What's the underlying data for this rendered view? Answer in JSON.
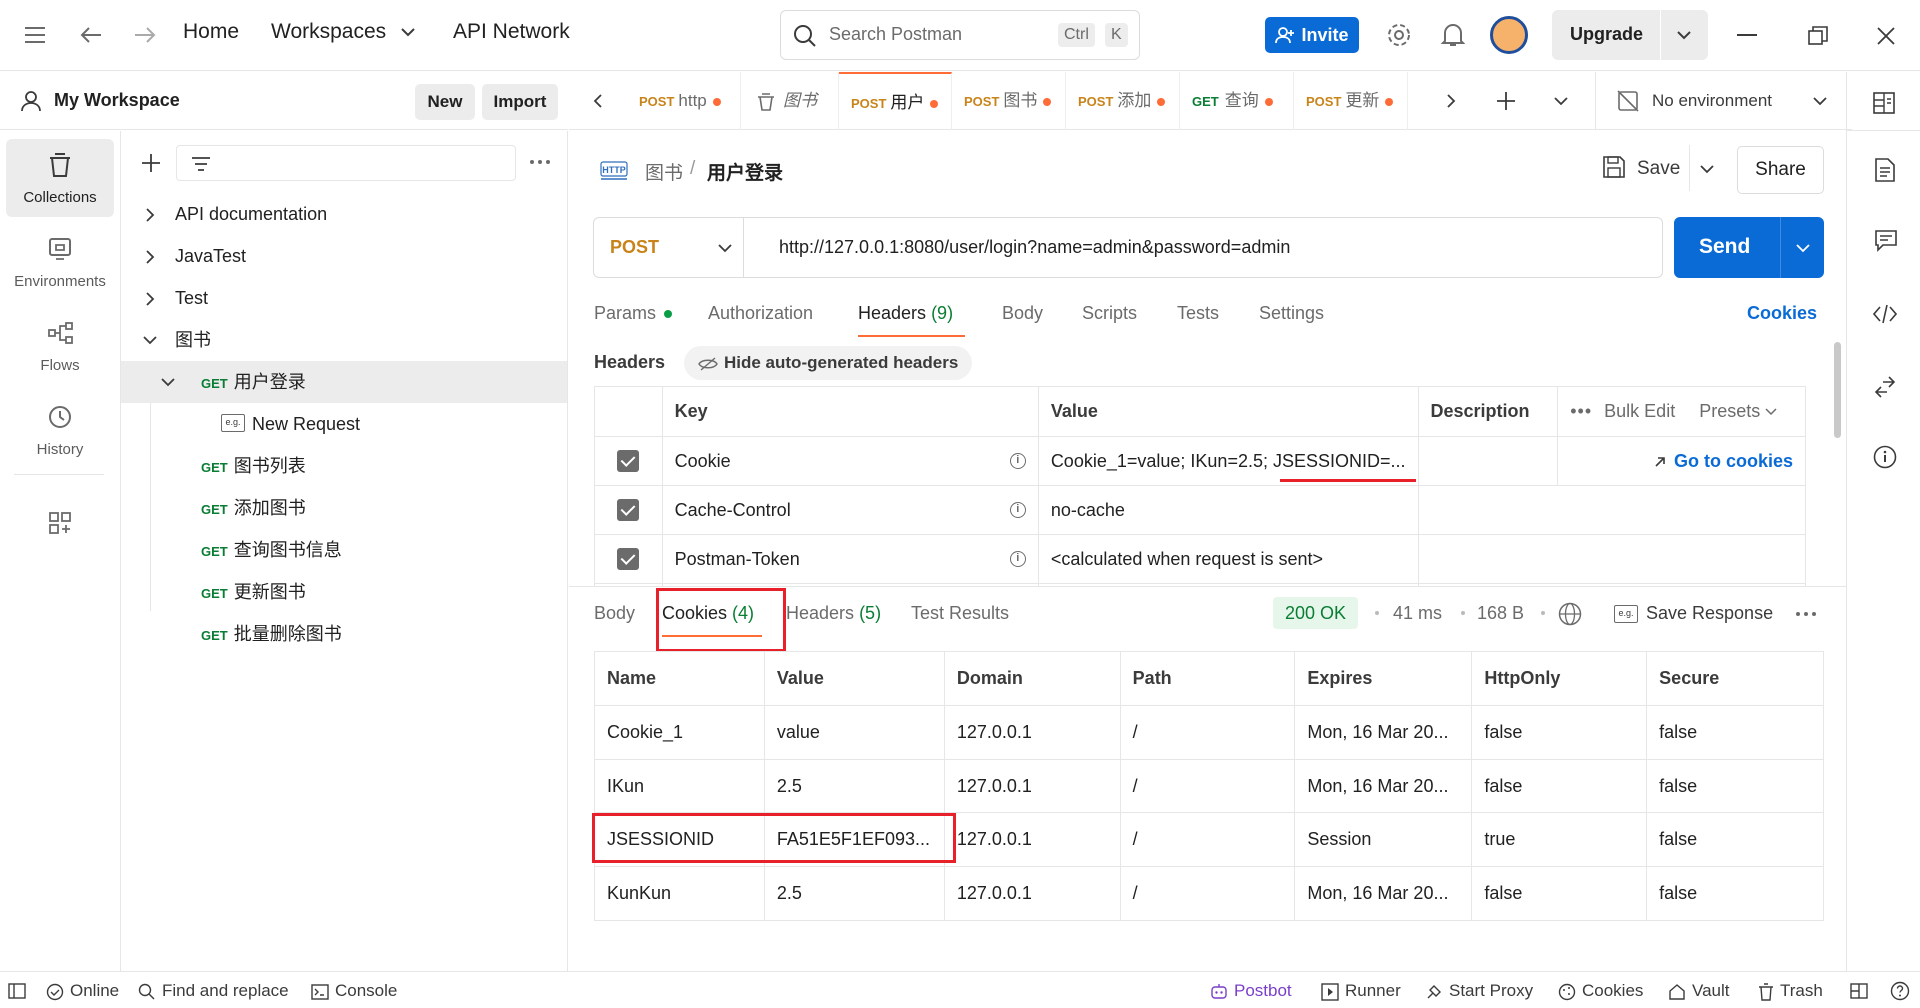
{
  "topbar": {
    "nav": [
      "Home",
      "Workspaces",
      "API Network"
    ],
    "search_placeholder": "Search Postman",
    "kbd_ctrl": "Ctrl",
    "kbd_k": "K",
    "invite": "Invite",
    "upgrade": "Upgrade"
  },
  "workspace": {
    "name": "My Workspace",
    "new": "New",
    "import": "Import"
  },
  "rail": [
    "Collections",
    "Environments",
    "Flows",
    "History"
  ],
  "tree": {
    "items": [
      {
        "label": "API documentation"
      },
      {
        "label": "JavaTest"
      },
      {
        "label": "Test"
      },
      {
        "label": "图书"
      }
    ],
    "requests": [
      {
        "method": "GET",
        "label": "用户登录"
      },
      {
        "badge": "e.g.",
        "label": "New Request"
      },
      {
        "method": "GET",
        "label": "图书列表"
      },
      {
        "method": "GET",
        "label": "添加图书"
      },
      {
        "method": "GET",
        "label": "查询图书信息"
      },
      {
        "method": "GET",
        "label": "更新图书"
      },
      {
        "method": "GET",
        "label": "批量删除图书"
      }
    ]
  },
  "tabs": [
    {
      "method": "POST",
      "label": "http"
    },
    {
      "method": "",
      "label": "图书"
    },
    {
      "method": "POST",
      "label": "用户"
    },
    {
      "method": "POST",
      "label": "图书"
    },
    {
      "method": "POST",
      "label": "添加"
    },
    {
      "method": "GET",
      "label": "查询"
    },
    {
      "method": "POST",
      "label": "更新"
    }
  ],
  "environment": "No environment",
  "request": {
    "breadcrumb_parent": "图书",
    "breadcrumb_sep": "/",
    "breadcrumb_current": "用户登录",
    "save": "Save",
    "share": "Share",
    "method": "POST",
    "url": "http://127.0.0.1:8080/user/login?name=admin&password=admin",
    "send": "Send",
    "tabs": {
      "params": "Params",
      "authorization": "Authorization",
      "headers": "Headers",
      "headers_count": "(9)",
      "body": "Body",
      "scripts": "Scripts",
      "tests": "Tests",
      "settings": "Settings",
      "cookies": "Cookies"
    },
    "headers_title": "Headers",
    "hide_auto": "Hide auto-generated headers",
    "header_cols": {
      "key": "Key",
      "value": "Value",
      "description": "Description",
      "bulk_edit": "Bulk Edit",
      "presets": "Presets"
    },
    "go_to_cookies": "Go to cookies",
    "header_rows": [
      {
        "key": "Cookie",
        "value": "Cookie_1=value; IKun=2.5; JSESSIONID=..."
      },
      {
        "key": "Cache-Control",
        "value": "no-cache"
      },
      {
        "key": "Postman-Token",
        "value": "<calculated when request is sent>"
      }
    ]
  },
  "response": {
    "tabs": {
      "body": "Body",
      "cookies": "Cookies",
      "cookies_count": "(4)",
      "headers": "Headers",
      "headers_count": "(5)",
      "tests": "Test Results"
    },
    "status": "200 OK",
    "time": "41 ms",
    "size": "168 B",
    "save_response": "Save Response",
    "cookie_cols": [
      "Name",
      "Value",
      "Domain",
      "Path",
      "Expires",
      "HttpOnly",
      "Secure"
    ],
    "cookies": [
      [
        "Cookie_1",
        "value",
        "127.0.0.1",
        "/",
        "Mon, 16 Mar 20...",
        "false",
        "false"
      ],
      [
        "IKun",
        "2.5",
        "127.0.0.1",
        "/",
        "Mon, 16 Mar 20...",
        "false",
        "false"
      ],
      [
        "JSESSIONID",
        "FA51E5F1EF093...",
        "127.0.0.1",
        "/",
        "Session",
        "true",
        "false"
      ],
      [
        "KunKun",
        "2.5",
        "127.0.0.1",
        "/",
        "Mon, 16 Mar 20...",
        "false",
        "false"
      ]
    ]
  },
  "statusbar": {
    "online": "Online",
    "find": "Find and replace",
    "console": "Console",
    "postbot": "Postbot",
    "runner": "Runner",
    "proxy": "Start Proxy",
    "cookies": "Cookies",
    "vault": "Vault",
    "trash": "Trash"
  },
  "colors": {
    "accent": "#ff6c37",
    "primary": "#0a6bd6",
    "get": "#0a7d34",
    "post": "#c8841a",
    "highlight": "#e8202a"
  }
}
